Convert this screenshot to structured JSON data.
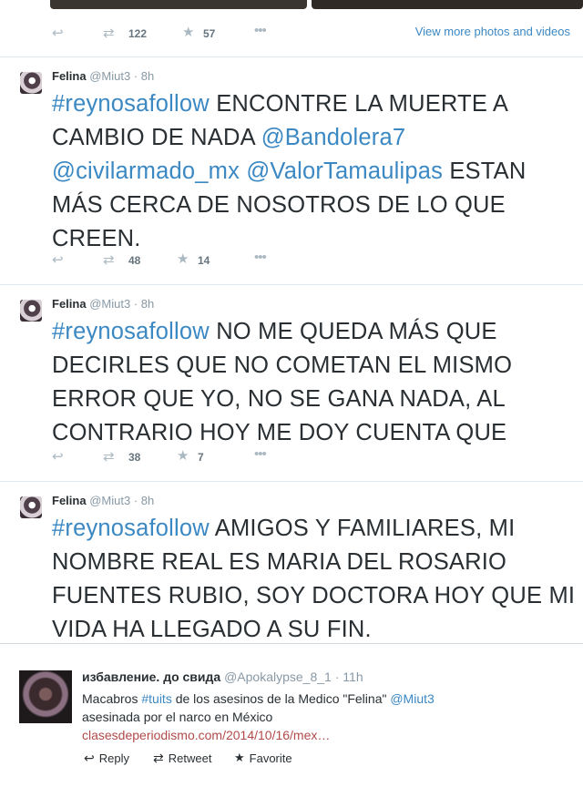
{
  "top": {
    "reply_icon": "reply-icon",
    "retweet_count": "122",
    "favorite_count": "57",
    "view_more": "View more photos and videos"
  },
  "tweets": [
    {
      "name": "Felina",
      "handle": "@Miut3",
      "time": "8h",
      "hashtag": "#reynosafollow",
      "text_before": " ENCONTRE LA MUERTE A CAMBIO DE NADA ",
      "mention1": "@Bandolera7",
      "mention2": "@civilarmado_mx",
      "mention3": "@ValorTamaulipas",
      "text_after": " ESTAN MÁS CERCA DE NOSOTROS DE LO QUE CREEN.",
      "retweets": "48",
      "favorites": "14"
    },
    {
      "name": "Felina",
      "handle": "@Miut3",
      "time": "8h",
      "hashtag": "#reynosafollow",
      "text": " NO ME QUEDA MÁS QUE DECIRLES QUE NO COMETAN EL MISMO ERROR QUE YO, NO SE GANA NADA, AL CONTRARIO HOY ME DOY CUENTA QUE",
      "retweets": "38",
      "favorites": "7"
    },
    {
      "name": "Felina",
      "handle": "@Miut3",
      "time": "8h",
      "hashtag": "#reynosafollow",
      "text": " AMIGOS Y FAMILIARES, MI NOMBRE REAL ES MARIA DEL ROSARIO FUENTES RUBIO,  SOY DOCTORA HOY QUE MI VIDA HA LLEGADO A SU FIN."
    }
  ],
  "embed": {
    "name": "избавление. до свида",
    "handle": "@Apokalypse_8_1",
    "time": "11h",
    "text_1": "Macabros ",
    "hashtag": "#tuits",
    "text_2": " de los asesinos de la Medico \"Felina\" ",
    "mention": "@Miut3",
    "text_3": "asesinada por el narco en  México",
    "link": "clasesdeperiodismo.com/2014/10/16/mex…",
    "reply_label": "Reply",
    "retweet_label": "Retweet",
    "favorite_label": "Favorite"
  },
  "colors": {
    "link": "#3b88c3",
    "muted": "#8899a6",
    "separator": "#e1e8ed"
  }
}
